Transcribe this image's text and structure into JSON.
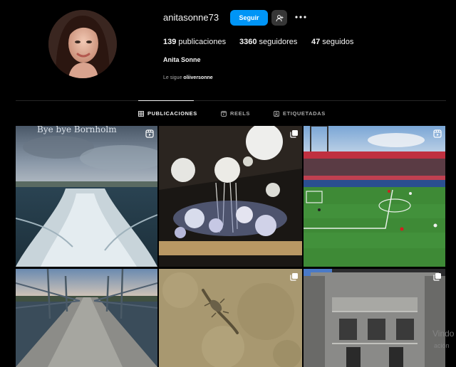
{
  "profile": {
    "username": "anitasonne73",
    "follow_label": "Seguir",
    "full_name": "Anita Sonne",
    "followed_by_prefix": "Le sigue ",
    "followed_by_user": "oliiversonne",
    "stats": {
      "posts_count": "139",
      "posts_label": " publicaciones",
      "followers_count": "3360",
      "followers_label": " seguidores",
      "following_count": "47",
      "following_label": " seguidos"
    }
  },
  "tabs": [
    {
      "label": "PUBLICACIONES",
      "icon": "grid-icon",
      "active": true
    },
    {
      "label": "REELS",
      "icon": "reels-icon",
      "active": false
    },
    {
      "label": "ETIQUETADAS",
      "icon": "tagged-icon",
      "active": false
    }
  ],
  "posts": [
    {
      "subject": "ferry-wake-sea",
      "overlay_text": "Bye bye Bornholm",
      "badge": "reel-icon"
    },
    {
      "subject": "paper-lantern-installation",
      "badge": "carousel-icon"
    },
    {
      "subject": "football-stadium",
      "badge": "reel-icon"
    },
    {
      "subject": "wooden-bridge-sunset",
      "badge": ""
    },
    {
      "subject": "lizard-on-sand",
      "badge": "carousel-icon"
    },
    {
      "subject": "tower-bridge-facade",
      "badge": "carousel-icon"
    }
  ],
  "watermark": {
    "line1": "Vindo",
    "line2": "ación"
  },
  "colors": {
    "accent": "#0095f6",
    "background": "#000000",
    "secondary_button": "#363636",
    "muted_text": "#a8a8a8"
  }
}
